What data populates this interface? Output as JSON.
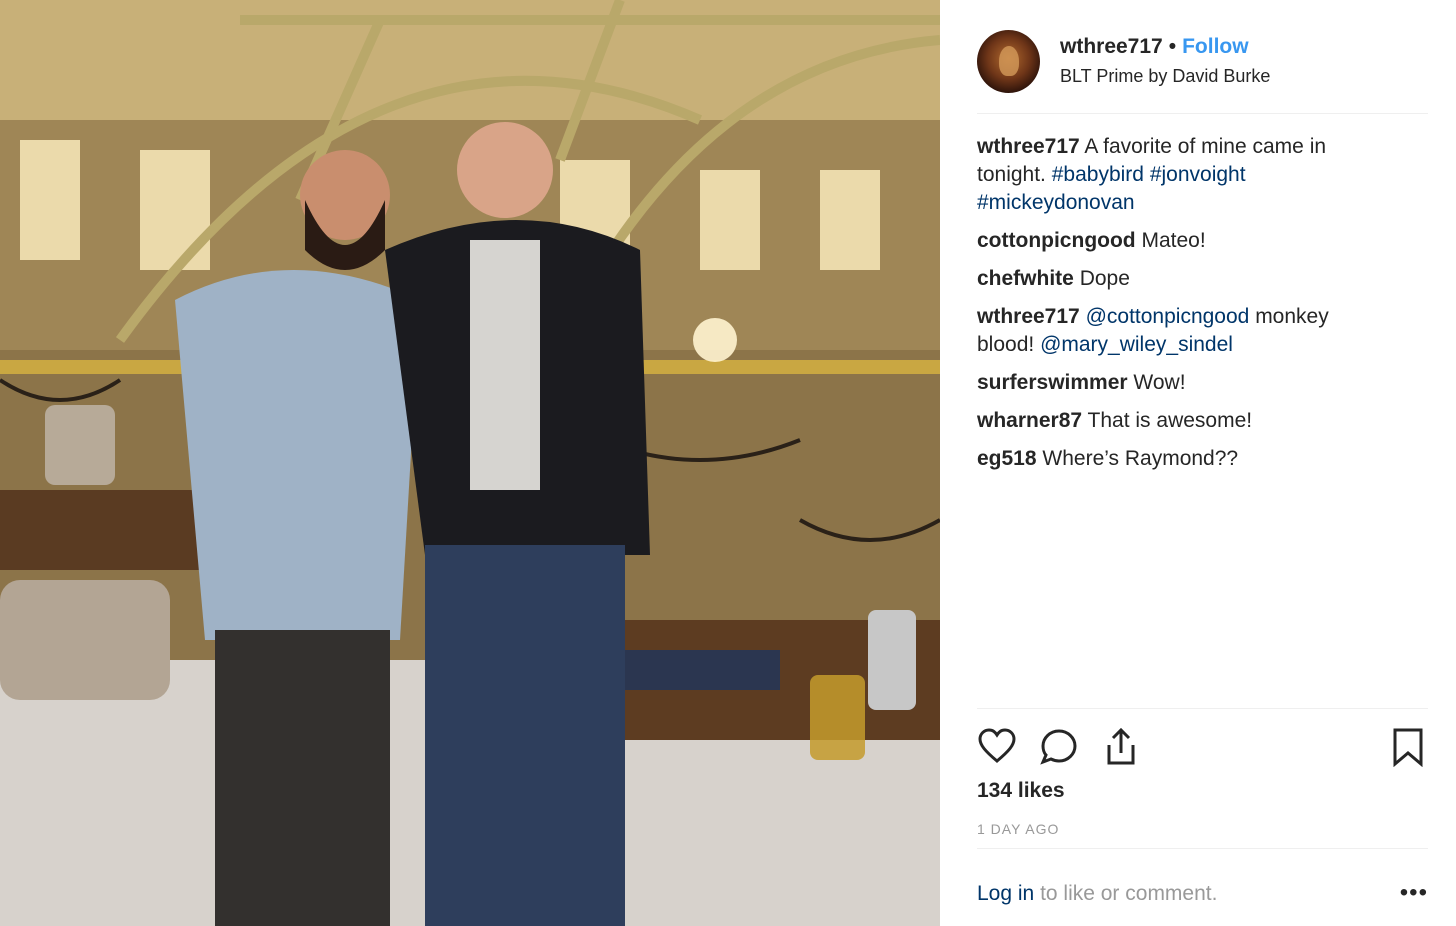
{
  "post": {
    "username": "wthree717",
    "separator": "•",
    "follow_label": "Follow",
    "location": "BLT Prime by David Burke",
    "photo_icon": "restaurant-photo",
    "avatar_icon": "profile-avatar"
  },
  "caption": {
    "username": "wthree717",
    "text": "A favorite of mine came in tonight.",
    "hashtags": [
      "#babybird",
      "#jonvoight",
      "#mickeydonovan"
    ]
  },
  "comments": [
    {
      "user": "cottonpicngood",
      "text": "Mateo!"
    },
    {
      "user": "chefwhite",
      "text": "Dope"
    },
    {
      "user": "wthree717",
      "mention1": "@cottonpicngood",
      "mid": "monkey blood!",
      "mention2": "@mary_wiley_sindel"
    },
    {
      "user": "surferswimmer",
      "text": "Wow!"
    },
    {
      "user": "wharner87",
      "text": "That is awesome!"
    },
    {
      "user": "eg518",
      "text": "Where’s Raymond??"
    }
  ],
  "actions": {
    "like_icon": "heart-icon",
    "comment_icon": "comment-icon",
    "share_icon": "share-icon",
    "save_icon": "bookmark-icon",
    "likes": "134 likes",
    "timestamp": "1 DAY AGO"
  },
  "login": {
    "link": "Log in",
    "text": "to like or comment.",
    "more": "•••"
  },
  "colors": {
    "follow": "#3897f0",
    "link": "#003569",
    "muted": "#999999",
    "text": "#262626"
  }
}
